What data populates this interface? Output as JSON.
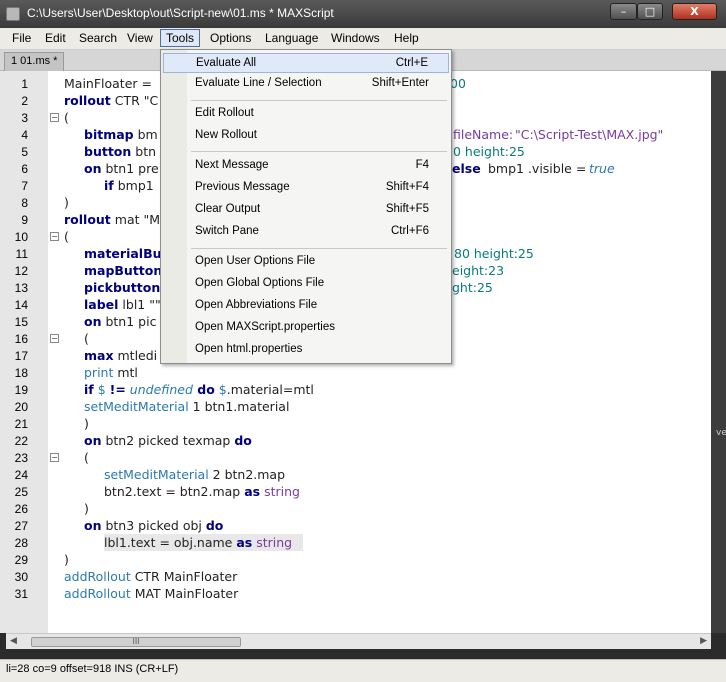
{
  "window": {
    "title": "C:\\Users\\User\\Desktop\\out\\Script-new\\01.ms * MAXScript",
    "minimize": "–",
    "maximize": "□",
    "close": "X"
  },
  "menubar": [
    "File",
    "Edit",
    "Search",
    "View",
    "Tools",
    "Options",
    "Language",
    "Windows",
    "Help"
  ],
  "tab": {
    "label": "1 01.ms *"
  },
  "tools_menu": {
    "group1": [
      {
        "label": "Evaluate All",
        "shortcut": "Ctrl+E"
      },
      {
        "label": "Evaluate Line / Selection",
        "shortcut": "Shift+Enter"
      }
    ],
    "group2": [
      {
        "label": "Edit Rollout",
        "shortcut": ""
      },
      {
        "label": "New Rollout",
        "shortcut": ""
      }
    ],
    "group3": [
      {
        "label": "Next Message",
        "shortcut": "F4"
      },
      {
        "label": "Previous Message",
        "shortcut": "Shift+F4"
      },
      {
        "label": "Clear Output",
        "shortcut": "Shift+F5"
      },
      {
        "label": "Switch Pane",
        "shortcut": "Ctrl+F6"
      }
    ],
    "group4": [
      {
        "label": "Open User Options File",
        "shortcut": ""
      },
      {
        "label": "Open Global Options File",
        "shortcut": ""
      },
      {
        "label": "Open Abbreviations File",
        "shortcut": ""
      },
      {
        "label": "Open MAXScript.properties",
        "shortcut": ""
      },
      {
        "label": "Open html.properties",
        "shortcut": ""
      }
    ]
  },
  "editor": {
    "line_numbers": [
      "1",
      "2",
      "3",
      "4",
      "5",
      "6",
      "7",
      "8",
      "9",
      "10",
      "11",
      "12",
      "13",
      "14",
      "15",
      "16",
      "17",
      "18",
      "19",
      "20",
      "21",
      "22",
      "23",
      "24",
      "25",
      "26",
      "27",
      "28",
      "29",
      "30",
      "31"
    ],
    "code": {
      "l1a": "MainFloater =",
      "l1b": "00",
      "l2a": "rollout",
      "l2b": " CTR \"C",
      "l3": "(",
      "l4a": "bitmap",
      "l4b": " bm",
      "l4c": "fileName:",
      "l4d": "\"C:\\Script-Test\\MAX.jpg\"",
      "l5a": "button",
      "l5b": " btn",
      "l5c": "0 height:25",
      "l6a": "on",
      "l6b": " btn1 pre",
      "l6c": "else",
      "l6d": " bmp1 .visible = ",
      "l6e": "true",
      "l7a": "if",
      "l7b": " bmp1",
      "l8": ")",
      "l9a": "rollout",
      "l9b": " mat \"M",
      "l10": "(",
      "l11a": "materialBu",
      "l11b": "80 height:25",
      "l12a": "mapButton",
      "l12b": "eight:23",
      "l13a": "pickbutton",
      "l13b": "ght:25",
      "l14a": "label",
      "l14b": " lbl1 \"\"",
      "l15a": "on",
      "l15b": " btn1 pic",
      "l16": "(",
      "l17a": "max",
      "l17b": " mtledi",
      "l18a": "print",
      "l18b": " mtl",
      "l19a": "if",
      "l19b": " $ ",
      "l19c": "!=",
      "l19d": " undefined",
      "l19e": " do",
      "l19f": " $",
      "l19g": ".material=mtl",
      "l20a": "setMeditMaterial",
      "l20b": " 1 btn1.material",
      "l21": ")",
      "l22a": "on",
      "l22b": " btn2 picked texmap ",
      "l22c": "do",
      "l23": "(",
      "l24a": "setMeditMaterial",
      "l24b": " 2 btn2.map",
      "l25a": "btn2.text = btn2.map ",
      "l25b": "as",
      "l25c": " string",
      "l26": ")",
      "l27a": "on",
      "l27b": " btn3 picked obj ",
      "l27c": "do",
      "l28a": "lbl1.text = obj.name ",
      "l28b": "as",
      "l28c": " string",
      "l29": ")",
      "l30a": "addRollout",
      "l30b": " CTR MainFloater",
      "l31a": "addRollout",
      "l31b": " MAT MainFloater"
    },
    "hscroll_thumb": "III",
    "right_edge": "ve"
  },
  "statusbar": {
    "text": "li=28 co=9 offset=918 INS (CR+LF)"
  }
}
